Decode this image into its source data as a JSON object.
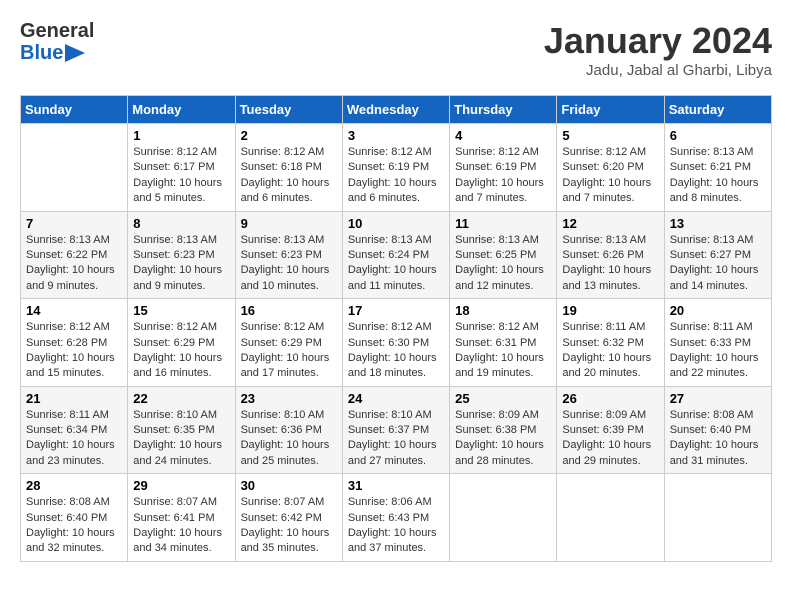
{
  "logo": {
    "text_general": "General",
    "text_blue": "Blue"
  },
  "header": {
    "month_year": "January 2024",
    "location": "Jadu, Jabal al Gharbi, Libya"
  },
  "weekdays": [
    "Sunday",
    "Monday",
    "Tuesday",
    "Wednesday",
    "Thursday",
    "Friday",
    "Saturday"
  ],
  "weeks": [
    [
      {
        "day": "",
        "info": ""
      },
      {
        "day": "1",
        "info": "Sunrise: 8:12 AM\nSunset: 6:17 PM\nDaylight: 10 hours\nand 5 minutes."
      },
      {
        "day": "2",
        "info": "Sunrise: 8:12 AM\nSunset: 6:18 PM\nDaylight: 10 hours\nand 6 minutes."
      },
      {
        "day": "3",
        "info": "Sunrise: 8:12 AM\nSunset: 6:19 PM\nDaylight: 10 hours\nand 6 minutes."
      },
      {
        "day": "4",
        "info": "Sunrise: 8:12 AM\nSunset: 6:19 PM\nDaylight: 10 hours\nand 7 minutes."
      },
      {
        "day": "5",
        "info": "Sunrise: 8:12 AM\nSunset: 6:20 PM\nDaylight: 10 hours\nand 7 minutes."
      },
      {
        "day": "6",
        "info": "Sunrise: 8:13 AM\nSunset: 6:21 PM\nDaylight: 10 hours\nand 8 minutes."
      }
    ],
    [
      {
        "day": "7",
        "info": "Sunrise: 8:13 AM\nSunset: 6:22 PM\nDaylight: 10 hours\nand 9 minutes."
      },
      {
        "day": "8",
        "info": "Sunrise: 8:13 AM\nSunset: 6:23 PM\nDaylight: 10 hours\nand 9 minutes."
      },
      {
        "day": "9",
        "info": "Sunrise: 8:13 AM\nSunset: 6:23 PM\nDaylight: 10 hours\nand 10 minutes."
      },
      {
        "day": "10",
        "info": "Sunrise: 8:13 AM\nSunset: 6:24 PM\nDaylight: 10 hours\nand 11 minutes."
      },
      {
        "day": "11",
        "info": "Sunrise: 8:13 AM\nSunset: 6:25 PM\nDaylight: 10 hours\nand 12 minutes."
      },
      {
        "day": "12",
        "info": "Sunrise: 8:13 AM\nSunset: 6:26 PM\nDaylight: 10 hours\nand 13 minutes."
      },
      {
        "day": "13",
        "info": "Sunrise: 8:13 AM\nSunset: 6:27 PM\nDaylight: 10 hours\nand 14 minutes."
      }
    ],
    [
      {
        "day": "14",
        "info": "Sunrise: 8:12 AM\nSunset: 6:28 PM\nDaylight: 10 hours\nand 15 minutes."
      },
      {
        "day": "15",
        "info": "Sunrise: 8:12 AM\nSunset: 6:29 PM\nDaylight: 10 hours\nand 16 minutes."
      },
      {
        "day": "16",
        "info": "Sunrise: 8:12 AM\nSunset: 6:29 PM\nDaylight: 10 hours\nand 17 minutes."
      },
      {
        "day": "17",
        "info": "Sunrise: 8:12 AM\nSunset: 6:30 PM\nDaylight: 10 hours\nand 18 minutes."
      },
      {
        "day": "18",
        "info": "Sunrise: 8:12 AM\nSunset: 6:31 PM\nDaylight: 10 hours\nand 19 minutes."
      },
      {
        "day": "19",
        "info": "Sunrise: 8:11 AM\nSunset: 6:32 PM\nDaylight: 10 hours\nand 20 minutes."
      },
      {
        "day": "20",
        "info": "Sunrise: 8:11 AM\nSunset: 6:33 PM\nDaylight: 10 hours\nand 22 minutes."
      }
    ],
    [
      {
        "day": "21",
        "info": "Sunrise: 8:11 AM\nSunset: 6:34 PM\nDaylight: 10 hours\nand 23 minutes."
      },
      {
        "day": "22",
        "info": "Sunrise: 8:10 AM\nSunset: 6:35 PM\nDaylight: 10 hours\nand 24 minutes."
      },
      {
        "day": "23",
        "info": "Sunrise: 8:10 AM\nSunset: 6:36 PM\nDaylight: 10 hours\nand 25 minutes."
      },
      {
        "day": "24",
        "info": "Sunrise: 8:10 AM\nSunset: 6:37 PM\nDaylight: 10 hours\nand 27 minutes."
      },
      {
        "day": "25",
        "info": "Sunrise: 8:09 AM\nSunset: 6:38 PM\nDaylight: 10 hours\nand 28 minutes."
      },
      {
        "day": "26",
        "info": "Sunrise: 8:09 AM\nSunset: 6:39 PM\nDaylight: 10 hours\nand 29 minutes."
      },
      {
        "day": "27",
        "info": "Sunrise: 8:08 AM\nSunset: 6:40 PM\nDaylight: 10 hours\nand 31 minutes."
      }
    ],
    [
      {
        "day": "28",
        "info": "Sunrise: 8:08 AM\nSunset: 6:40 PM\nDaylight: 10 hours\nand 32 minutes."
      },
      {
        "day": "29",
        "info": "Sunrise: 8:07 AM\nSunset: 6:41 PM\nDaylight: 10 hours\nand 34 minutes."
      },
      {
        "day": "30",
        "info": "Sunrise: 8:07 AM\nSunset: 6:42 PM\nDaylight: 10 hours\nand 35 minutes."
      },
      {
        "day": "31",
        "info": "Sunrise: 8:06 AM\nSunset: 6:43 PM\nDaylight: 10 hours\nand 37 minutes."
      },
      {
        "day": "",
        "info": ""
      },
      {
        "day": "",
        "info": ""
      },
      {
        "day": "",
        "info": ""
      }
    ]
  ]
}
